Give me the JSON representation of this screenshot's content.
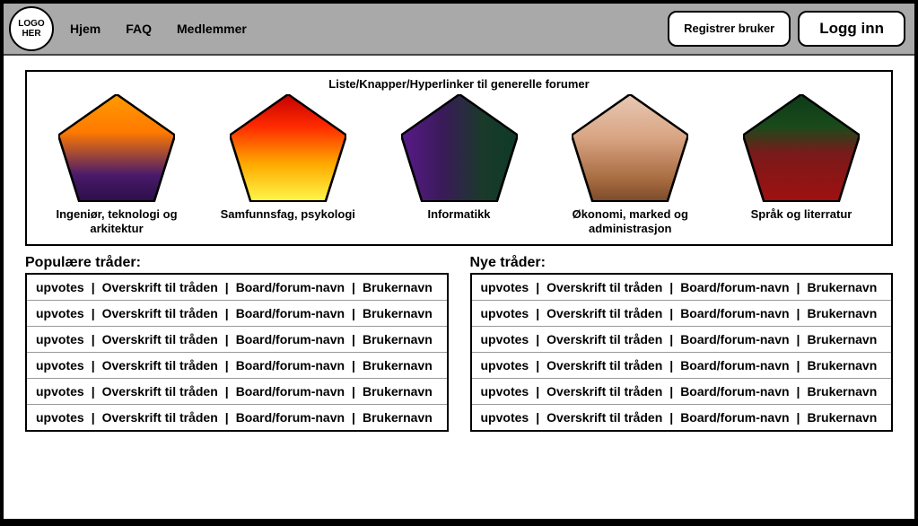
{
  "header": {
    "logo_text": "LOGO HER",
    "nav": [
      "Hjem",
      "FAQ",
      "Medlemmer"
    ],
    "register_label": "Registrer bruker",
    "login_label": "Logg inn"
  },
  "forums": {
    "title": "Liste/Knapper/Hyperlinker til generelle forumer",
    "items": [
      {
        "label": "Ingeniør, teknologi og arkitektur",
        "gradient": "g1"
      },
      {
        "label": "Samfunnsfag, psykologi",
        "gradient": "g2"
      },
      {
        "label": "Informatikk",
        "gradient": "g3"
      },
      {
        "label": "Økonomi, marked og administrasjon",
        "gradient": "g4"
      },
      {
        "label": "Språk og literratur",
        "gradient": "g5"
      }
    ]
  },
  "threads": {
    "popular_title": "Populære tråder:",
    "new_title": "Nye tråder:",
    "row_fields": [
      "upvotes",
      "Overskrift til tråden",
      "Board/forum-navn",
      "Brukernavn"
    ],
    "count": 6
  }
}
